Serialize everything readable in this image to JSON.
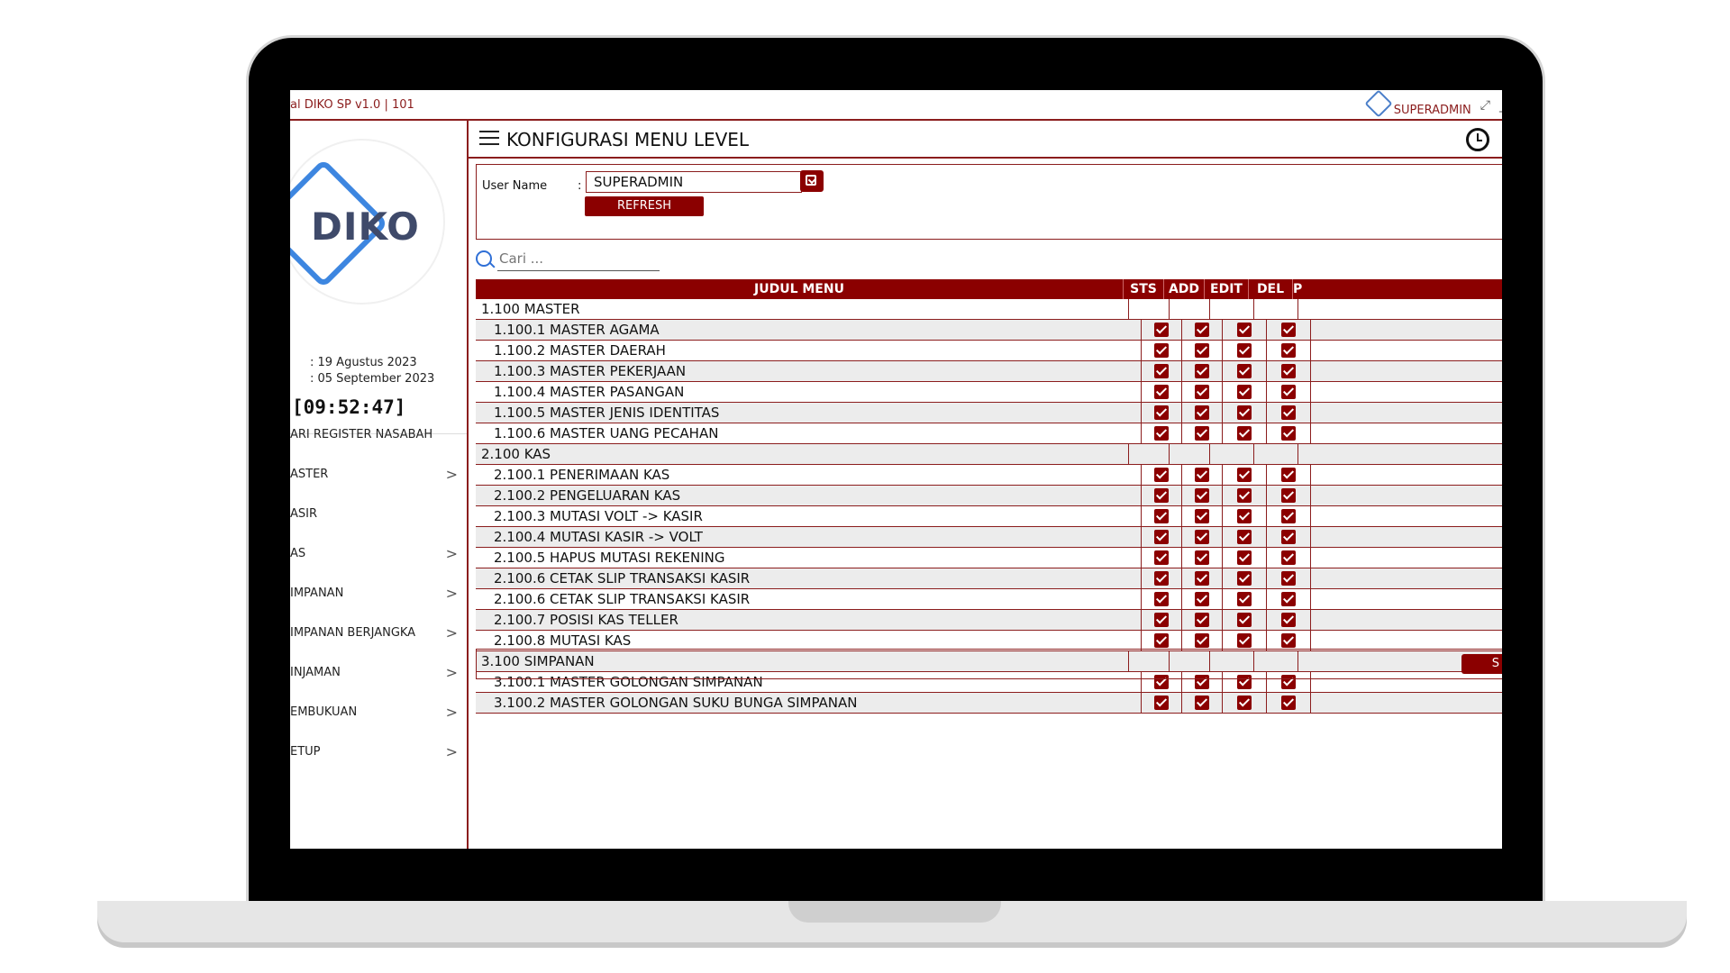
{
  "app": {
    "title": "al DIKO SP v1.0 | 101",
    "user": "SUPERADMIN",
    "logo_text": "DIKO",
    "mini_logo_text": "DIKO"
  },
  "sidebar": {
    "date1": ": 19 Agustus 2023",
    "date2": ": 05 September 2023",
    "clock": "[09:52:47]",
    "items": [
      {
        "label": "ARI REGISTER NASABAH",
        "chevron": ""
      },
      {
        "label": "ASTER",
        "chevron": ">"
      },
      {
        "label": "ASIR",
        "chevron": ""
      },
      {
        "label": "AS",
        "chevron": ">"
      },
      {
        "label": "IMPANAN",
        "chevron": ">"
      },
      {
        "label": "IMPANAN BERJANGKA",
        "chevron": ">"
      },
      {
        "label": "INJAMAN",
        "chevron": ">"
      },
      {
        "label": "EMBUKUAN",
        "chevron": ">"
      },
      {
        "label": "ETUP",
        "chevron": ">"
      }
    ]
  },
  "header": {
    "title": "KONFIGURASI MENU LEVEL"
  },
  "form": {
    "user_label": "User Name",
    "colon": ":",
    "user_value": "SUPERADMIN",
    "refresh_label": "REFRESH"
  },
  "search": {
    "placeholder": "Cari ..."
  },
  "table": {
    "columns": [
      "JUDUL MENU",
      "STS",
      "ADD",
      "EDIT",
      "DEL",
      "P"
    ],
    "rows": [
      {
        "title": "1.100 MASTER",
        "group": true
      },
      {
        "title": "1.100.1 MASTER AGAMA",
        "group": false
      },
      {
        "title": "1.100.2 MASTER DAERAH",
        "group": false
      },
      {
        "title": "1.100.3 MASTER PEKERJAAN",
        "group": false
      },
      {
        "title": "1.100.4 MASTER PASANGAN",
        "group": false
      },
      {
        "title": "1.100.5 MASTER JENIS IDENTITAS",
        "group": false
      },
      {
        "title": "1.100.6 MASTER UANG PECAHAN",
        "group": false
      },
      {
        "title": "2.100 KAS",
        "group": true
      },
      {
        "title": "2.100.1 PENERIMAAN KAS",
        "group": false
      },
      {
        "title": "2.100.2 PENGELUARAN KAS",
        "group": false
      },
      {
        "title": "2.100.3 MUTASI VOLT -> KASIR",
        "group": false
      },
      {
        "title": "2.100.4 MUTASI KASIR -> VOLT",
        "group": false
      },
      {
        "title": "2.100.5 HAPUS MUTASI REKENING",
        "group": false
      },
      {
        "title": "2.100.6 CETAK SLIP TRANSAKSI KASIR",
        "group": false
      },
      {
        "title": "2.100.6 CETAK SLIP TRANSAKSI KASIR",
        "group": false
      },
      {
        "title": "2.100.7 POSISI KAS TELLER",
        "group": false
      },
      {
        "title": "2.100.8 MUTASI KAS",
        "group": false
      },
      {
        "title": "3.100 SIMPANAN",
        "group": true
      },
      {
        "title": "3.100.1 MASTER GOLONGAN SIMPANAN",
        "group": false
      },
      {
        "title": "3.100.2 MASTER GOLONGAN SUKU BUNGA SIMPANAN",
        "group": false
      }
    ]
  },
  "footer": {
    "save_label": "S"
  }
}
